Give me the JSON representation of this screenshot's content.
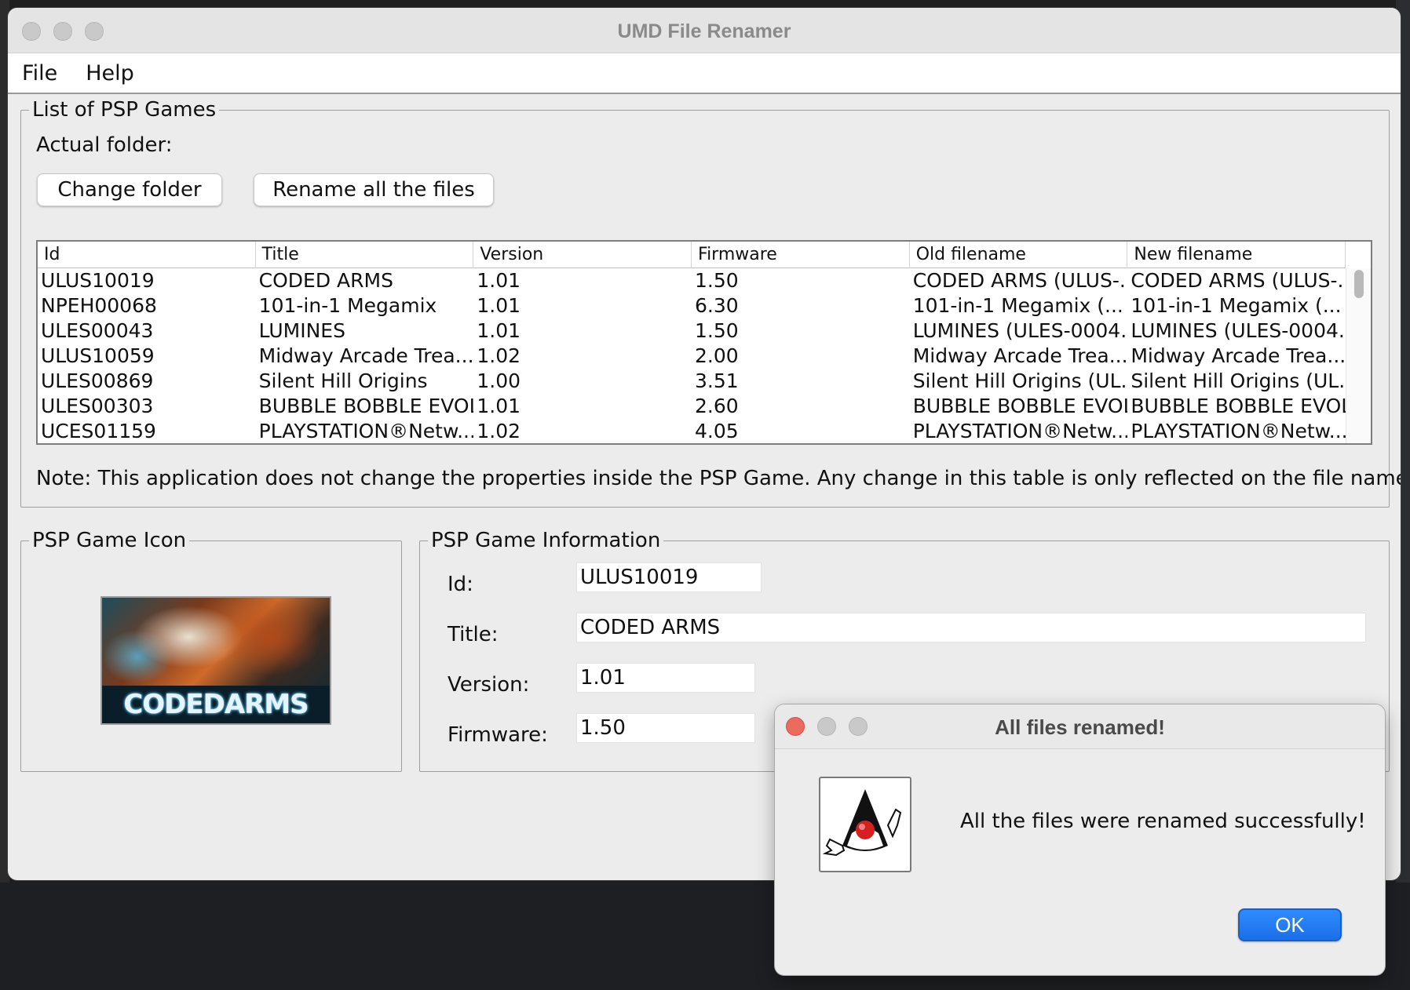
{
  "window": {
    "title": "UMD File Renamer"
  },
  "menu": {
    "file": "File",
    "help": "Help"
  },
  "games_panel": {
    "legend": "List of PSP Games",
    "actual_folder_label": "Actual folder:",
    "change_folder_button": "Change folder",
    "rename_all_button": "Rename all the files",
    "note": "Note: This application does not change the properties inside the PSP Game. Any change in this table is only reflected on the file names."
  },
  "table": {
    "columns": [
      "Id",
      "Title",
      "Version",
      "Firmware",
      "Old filename",
      "New filename"
    ],
    "rows": [
      [
        "ULUS10019",
        "CODED ARMS",
        "1.01",
        "1.50",
        "CODED ARMS (ULUS-...",
        "CODED ARMS (ULUS-..."
      ],
      [
        "NPEH00068",
        "101-in-1 Megamix",
        "1.01",
        "6.30",
        "101-in-1 Megamix (...",
        "101-in-1 Megamix (..."
      ],
      [
        "ULES00043",
        "LUMINES",
        "1.01",
        "1.50",
        "LUMINES (ULES-0004...",
        "LUMINES (ULES-0004..."
      ],
      [
        "ULUS10059",
        "Midway Arcade Trea...",
        "1.02",
        "2.00",
        "Midway Arcade Trea...",
        "Midway Arcade Trea..."
      ],
      [
        "ULES00869",
        "Silent Hill Origins",
        "1.00",
        "3.51",
        "Silent Hill Origins (UL...",
        "Silent Hill Origins (UL..."
      ],
      [
        "ULES00303",
        "BUBBLE BOBBLE EVOL...",
        "1.01",
        "2.60",
        "BUBBLE BOBBLE EVOL...",
        "BUBBLE BOBBLE EVOL..."
      ],
      [
        "UCES01159",
        "PLAYSTATION®Netw...",
        "1.02",
        "4.05",
        "PLAYSTATION®Netw...",
        "PLAYSTATION®Netw..."
      ]
    ]
  },
  "icon_panel": {
    "legend": "PSP Game Icon",
    "image_text": "CODEDARMS"
  },
  "info_panel": {
    "legend": "PSP Game Information",
    "id_label": "Id:",
    "id_value": "ULUS10019",
    "title_label": "Title:",
    "title_value": "CODED ARMS",
    "version_label": "Version:",
    "version_value": "1.01",
    "firmware_label": "Firmware:",
    "firmware_value": "1.50"
  },
  "dialog": {
    "title": "All files renamed!",
    "message": "All the files were renamed successfully!",
    "ok_button": "OK",
    "icon": "java-duke-icon"
  },
  "colors": {
    "window_bg": "#ececec",
    "ok_button": "#1b6fe8",
    "close_red": "#ed6a5e"
  }
}
